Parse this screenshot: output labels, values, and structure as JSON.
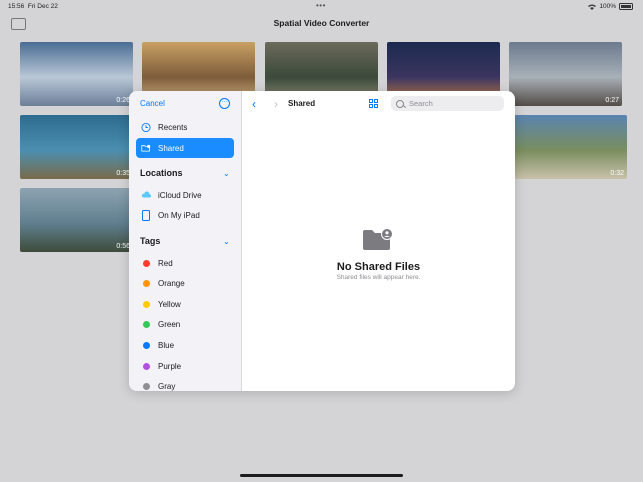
{
  "status_bar": {
    "time": "15:56",
    "date": "Fri Dec 22",
    "battery": "100%"
  },
  "app": {
    "title": "Spatial Video Converter"
  },
  "gallery": [
    {
      "duration": "0:26",
      "colors": [
        "#4a6d94",
        "#b9c7d6",
        "#6c7f99"
      ]
    },
    {
      "duration": "",
      "colors": [
        "#c9a063",
        "#7d5c3a",
        "#e3c490"
      ]
    },
    {
      "duration": "",
      "colors": [
        "#6c6a5c",
        "#3b4a3a",
        "#9d9a86"
      ]
    },
    {
      "duration": "",
      "colors": [
        "#1c2a4f",
        "#3b3560",
        "#d88c45"
      ]
    },
    {
      "duration": "0:27",
      "colors": [
        "#6c7a8e",
        "#a8b0b8",
        "#544c46"
      ]
    },
    {
      "duration": "0:35",
      "colors": [
        "#2d6b8f",
        "#4b8fb0",
        "#7a6b4a"
      ]
    },
    {
      "duration": "0:32",
      "colors": [
        "#5a84b0",
        "#7a8e5f",
        "#c9c1ab"
      ]
    },
    {
      "duration": "0:56",
      "colors": [
        "#8ea3b1",
        "#5f7f8f",
        "#3e4c3a"
      ]
    }
  ],
  "picker": {
    "cancel_label": "Cancel",
    "recents_label": "Recents",
    "shared_label": "Shared",
    "locations_header": "Locations",
    "icloud_label": "iCloud Drive",
    "ipad_label": "On My iPad",
    "tags_header": "Tags",
    "tags": [
      {
        "label": "Red",
        "color": "#ff3b30"
      },
      {
        "label": "Orange",
        "color": "#ff9500"
      },
      {
        "label": "Yellow",
        "color": "#ffcc00"
      },
      {
        "label": "Green",
        "color": "#34c759"
      },
      {
        "label": "Blue",
        "color": "#007aff"
      },
      {
        "label": "Purple",
        "color": "#af52de"
      },
      {
        "label": "Gray",
        "color": "#8e8e93"
      }
    ],
    "location_title": "Shared",
    "search_placeholder": "Search",
    "empty_title": "No Shared Files",
    "empty_subtitle": "Shared files will appear here."
  }
}
